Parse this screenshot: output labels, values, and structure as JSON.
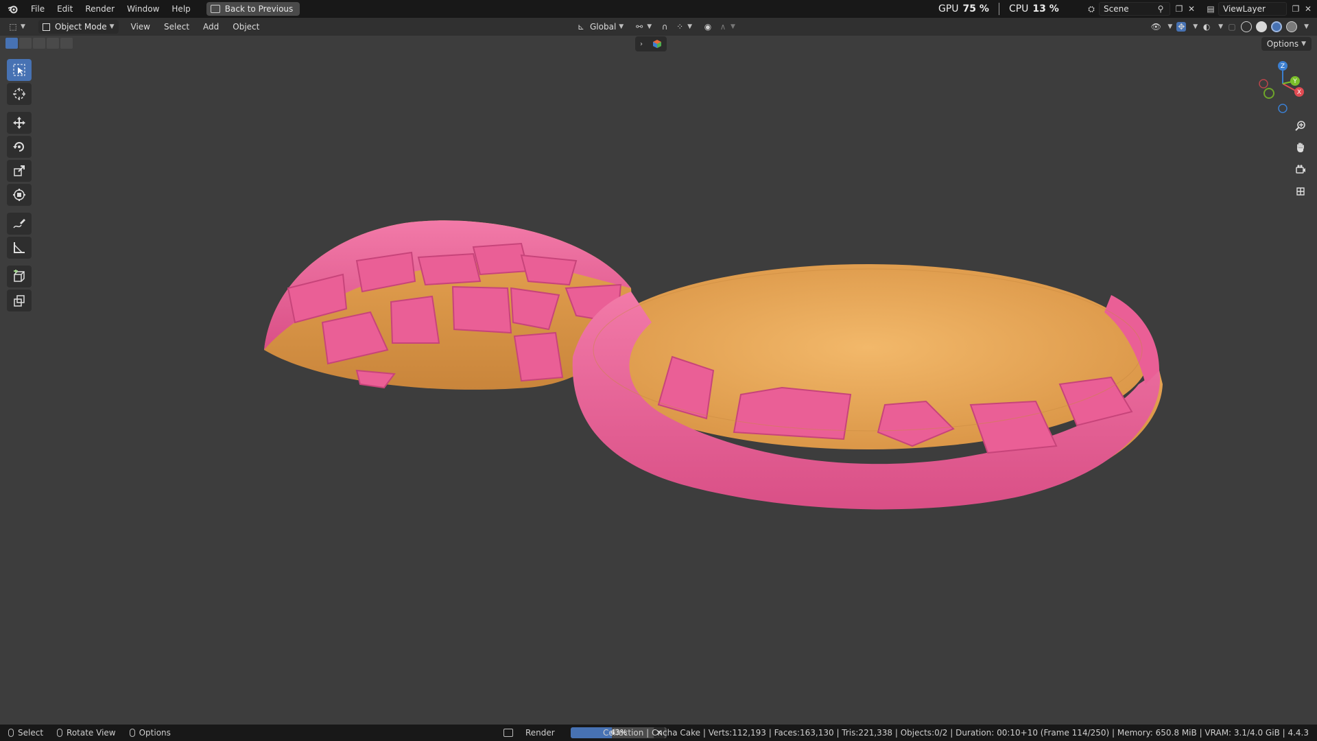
{
  "topbar": {
    "menus": [
      "File",
      "Edit",
      "Render",
      "Window",
      "Help"
    ],
    "back_button": "Back to Previous",
    "gpu_label": "GPU",
    "gpu_value": "75 %",
    "cpu_label": "CPU",
    "cpu_value": "13 %",
    "scene_name": "Scene",
    "view_layer": "ViewLayer"
  },
  "header": {
    "mode": "Object Mode",
    "menus": [
      "View",
      "Select",
      "Add",
      "Object"
    ],
    "transform_orientation": "Global"
  },
  "viewport": {
    "options_label": "Options",
    "gizmo_axes": [
      "Z",
      "Y",
      "X"
    ]
  },
  "statusbar": {
    "hints": [
      "Select",
      "Rotate View",
      "Options"
    ],
    "render_label": "Render",
    "progress_percent": 43,
    "progress_text": "43%",
    "info": "Collection | Cncha Cake | Verts:112,193 | Faces:163,130 | Tris:221,338 | Objects:0/2 | Duration: 00:10+10 (Frame 114/250) | Memory: 650.8 MiB | VRAM: 3.1/4.0 GiB | 4.4.3"
  },
  "colors": {
    "accent": "#4772b3",
    "viewport_bg": "#3d3d3d",
    "pink_crust": "#ec6598",
    "bread": "#e9a654"
  },
  "icons": [
    "blender-logo",
    "back-icon",
    "cube-icon",
    "select-box-icon",
    "cursor-icon",
    "move-icon",
    "rotate-icon",
    "scale-icon",
    "transform-icon",
    "annotate-icon",
    "measure-icon",
    "add-cube-icon",
    "extrude-icon",
    "zoom-icon",
    "hand-icon",
    "camera-icon",
    "grid-icon"
  ]
}
